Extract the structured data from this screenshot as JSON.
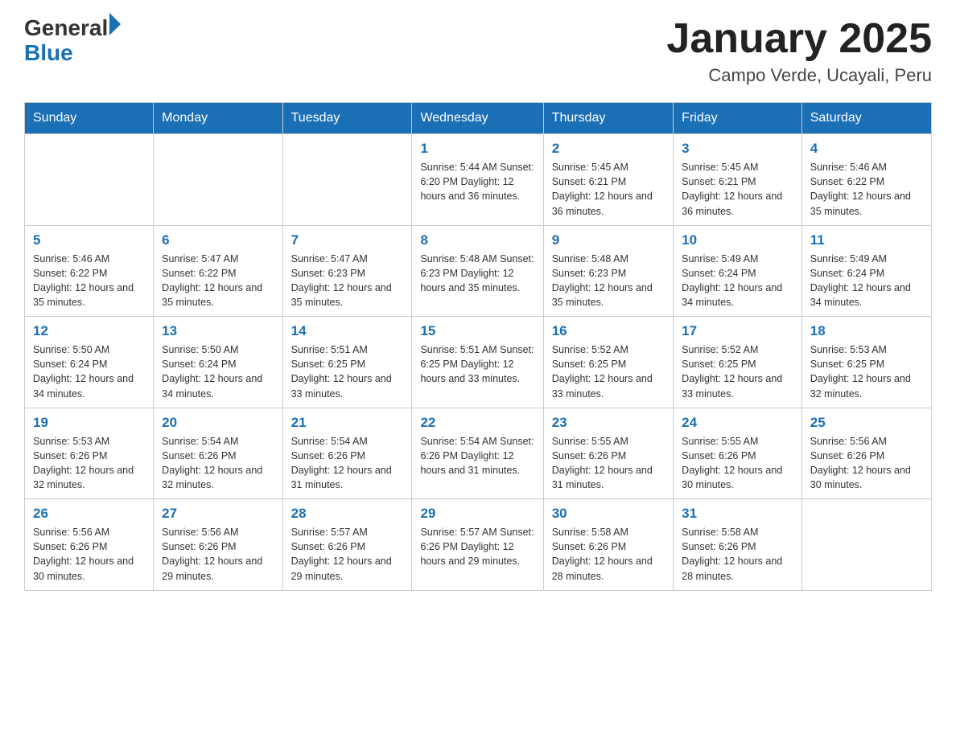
{
  "header": {
    "logo_general": "General",
    "logo_blue": "Blue",
    "month_title": "January 2025",
    "location": "Campo Verde, Ucayali, Peru"
  },
  "weekdays": [
    "Sunday",
    "Monday",
    "Tuesday",
    "Wednesday",
    "Thursday",
    "Friday",
    "Saturday"
  ],
  "weeks": [
    [
      {
        "day": "",
        "info": ""
      },
      {
        "day": "",
        "info": ""
      },
      {
        "day": "",
        "info": ""
      },
      {
        "day": "1",
        "info": "Sunrise: 5:44 AM\nSunset: 6:20 PM\nDaylight: 12 hours\nand 36 minutes."
      },
      {
        "day": "2",
        "info": "Sunrise: 5:45 AM\nSunset: 6:21 PM\nDaylight: 12 hours\nand 36 minutes."
      },
      {
        "day": "3",
        "info": "Sunrise: 5:45 AM\nSunset: 6:21 PM\nDaylight: 12 hours\nand 36 minutes."
      },
      {
        "day": "4",
        "info": "Sunrise: 5:46 AM\nSunset: 6:22 PM\nDaylight: 12 hours\nand 35 minutes."
      }
    ],
    [
      {
        "day": "5",
        "info": "Sunrise: 5:46 AM\nSunset: 6:22 PM\nDaylight: 12 hours\nand 35 minutes."
      },
      {
        "day": "6",
        "info": "Sunrise: 5:47 AM\nSunset: 6:22 PM\nDaylight: 12 hours\nand 35 minutes."
      },
      {
        "day": "7",
        "info": "Sunrise: 5:47 AM\nSunset: 6:23 PM\nDaylight: 12 hours\nand 35 minutes."
      },
      {
        "day": "8",
        "info": "Sunrise: 5:48 AM\nSunset: 6:23 PM\nDaylight: 12 hours\nand 35 minutes."
      },
      {
        "day": "9",
        "info": "Sunrise: 5:48 AM\nSunset: 6:23 PM\nDaylight: 12 hours\nand 35 minutes."
      },
      {
        "day": "10",
        "info": "Sunrise: 5:49 AM\nSunset: 6:24 PM\nDaylight: 12 hours\nand 34 minutes."
      },
      {
        "day": "11",
        "info": "Sunrise: 5:49 AM\nSunset: 6:24 PM\nDaylight: 12 hours\nand 34 minutes."
      }
    ],
    [
      {
        "day": "12",
        "info": "Sunrise: 5:50 AM\nSunset: 6:24 PM\nDaylight: 12 hours\nand 34 minutes."
      },
      {
        "day": "13",
        "info": "Sunrise: 5:50 AM\nSunset: 6:24 PM\nDaylight: 12 hours\nand 34 minutes."
      },
      {
        "day": "14",
        "info": "Sunrise: 5:51 AM\nSunset: 6:25 PM\nDaylight: 12 hours\nand 33 minutes."
      },
      {
        "day": "15",
        "info": "Sunrise: 5:51 AM\nSunset: 6:25 PM\nDaylight: 12 hours\nand 33 minutes."
      },
      {
        "day": "16",
        "info": "Sunrise: 5:52 AM\nSunset: 6:25 PM\nDaylight: 12 hours\nand 33 minutes."
      },
      {
        "day": "17",
        "info": "Sunrise: 5:52 AM\nSunset: 6:25 PM\nDaylight: 12 hours\nand 33 minutes."
      },
      {
        "day": "18",
        "info": "Sunrise: 5:53 AM\nSunset: 6:25 PM\nDaylight: 12 hours\nand 32 minutes."
      }
    ],
    [
      {
        "day": "19",
        "info": "Sunrise: 5:53 AM\nSunset: 6:26 PM\nDaylight: 12 hours\nand 32 minutes."
      },
      {
        "day": "20",
        "info": "Sunrise: 5:54 AM\nSunset: 6:26 PM\nDaylight: 12 hours\nand 32 minutes."
      },
      {
        "day": "21",
        "info": "Sunrise: 5:54 AM\nSunset: 6:26 PM\nDaylight: 12 hours\nand 31 minutes."
      },
      {
        "day": "22",
        "info": "Sunrise: 5:54 AM\nSunset: 6:26 PM\nDaylight: 12 hours\nand 31 minutes."
      },
      {
        "day": "23",
        "info": "Sunrise: 5:55 AM\nSunset: 6:26 PM\nDaylight: 12 hours\nand 31 minutes."
      },
      {
        "day": "24",
        "info": "Sunrise: 5:55 AM\nSunset: 6:26 PM\nDaylight: 12 hours\nand 30 minutes."
      },
      {
        "day": "25",
        "info": "Sunrise: 5:56 AM\nSunset: 6:26 PM\nDaylight: 12 hours\nand 30 minutes."
      }
    ],
    [
      {
        "day": "26",
        "info": "Sunrise: 5:56 AM\nSunset: 6:26 PM\nDaylight: 12 hours\nand 30 minutes."
      },
      {
        "day": "27",
        "info": "Sunrise: 5:56 AM\nSunset: 6:26 PM\nDaylight: 12 hours\nand 29 minutes."
      },
      {
        "day": "28",
        "info": "Sunrise: 5:57 AM\nSunset: 6:26 PM\nDaylight: 12 hours\nand 29 minutes."
      },
      {
        "day": "29",
        "info": "Sunrise: 5:57 AM\nSunset: 6:26 PM\nDaylight: 12 hours\nand 29 minutes."
      },
      {
        "day": "30",
        "info": "Sunrise: 5:58 AM\nSunset: 6:26 PM\nDaylight: 12 hours\nand 28 minutes."
      },
      {
        "day": "31",
        "info": "Sunrise: 5:58 AM\nSunset: 6:26 PM\nDaylight: 12 hours\nand 28 minutes."
      },
      {
        "day": "",
        "info": ""
      }
    ]
  ]
}
